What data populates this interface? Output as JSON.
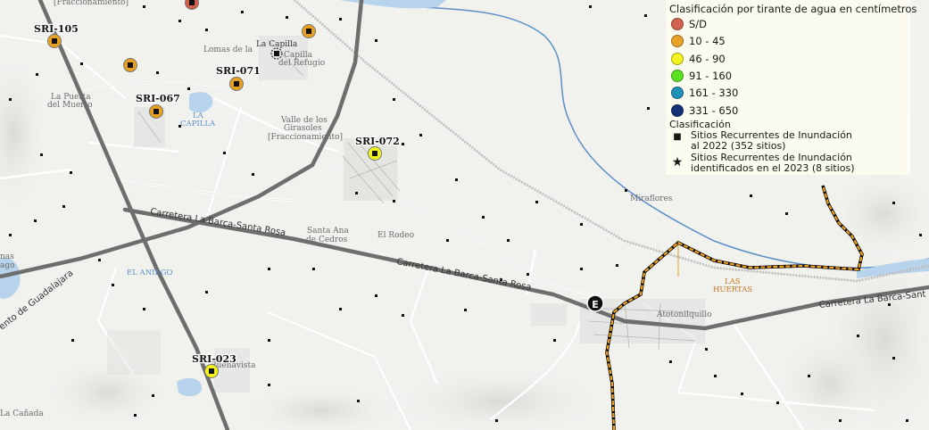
{
  "legend": {
    "title": "Clasificación por tirante de agua en centímetros",
    "items": [
      {
        "label": "S/D",
        "color": "#d1604a"
      },
      {
        "label": "10 - 45",
        "color": "#e8a020"
      },
      {
        "label": "46 - 90",
        "color": "#f4f41a"
      },
      {
        "label": "91 - 160",
        "color": "#55e21a"
      },
      {
        "label": "161 - 330",
        "color": "#1a8fb8"
      },
      {
        "label": "331 - 650",
        "color": "#0d2a73"
      }
    ],
    "symbol_title": "Clasificación",
    "symbols": [
      {
        "icon": "square-icon",
        "line1": "Sitios Recurrentes de Inundación",
        "line2": "al 2022 (352 sitios)"
      },
      {
        "icon": "star-icon",
        "line1": "Sitios Recurrentes de Inundación",
        "line2": "identificados en el 2023 (8 sitios)"
      }
    ]
  },
  "sites": [
    {
      "id": "SRI-105",
      "class": "10 - 45"
    },
    {
      "id": "SRI-071",
      "class": "10 - 45"
    },
    {
      "id": "SRI-067",
      "class": "10 - 45"
    },
    {
      "id": "SRI-072",
      "class": "46 - 90"
    },
    {
      "id": "SRI-023",
      "class": "46 - 90"
    }
  ],
  "places": {
    "fraccionamiento_top": "[Fraccionamiento]",
    "lomas": "Lomas de la",
    "la_capilla": "La Capilla",
    "capilla_refugio_1": "Capilla",
    "capilla_refugio_2": "del Refugio",
    "puerta_1": "La Puerta",
    "puerta_2": "del Muerto",
    "la_capilla_water_1": "LA",
    "la_capilla_water_2": "CAPILLA",
    "valle_1": "Valle de los",
    "valle_2": "Girasoles",
    "valle_3": "[Fraccionamiento]",
    "santa_ana_1": "Santa Ana",
    "santa_ana_2": "de Cedros",
    "el_rodeo": "El Rodeo",
    "el_aniego": "EL ANIEGO",
    "miraflores": "Miraflores",
    "las_huertas_1": "LAS",
    "las_huertas_2": "HUERTAS",
    "atotonilquillo": "Atotonilquillo",
    "buenavista": "Buenavista",
    "canada": "La Cañada",
    "lago_1": "nas",
    "lago_2": "ago"
  },
  "roads": {
    "carretera_1": "Carretera La Barca-Santa Rosa",
    "carretera_2": "Carretera La Barca-Santa Rosa",
    "carretera_3": "Carretera La Barca-Sant",
    "guadalajara": "ento de Guadalajara"
  },
  "markers": {
    "highway_shield": "E"
  }
}
